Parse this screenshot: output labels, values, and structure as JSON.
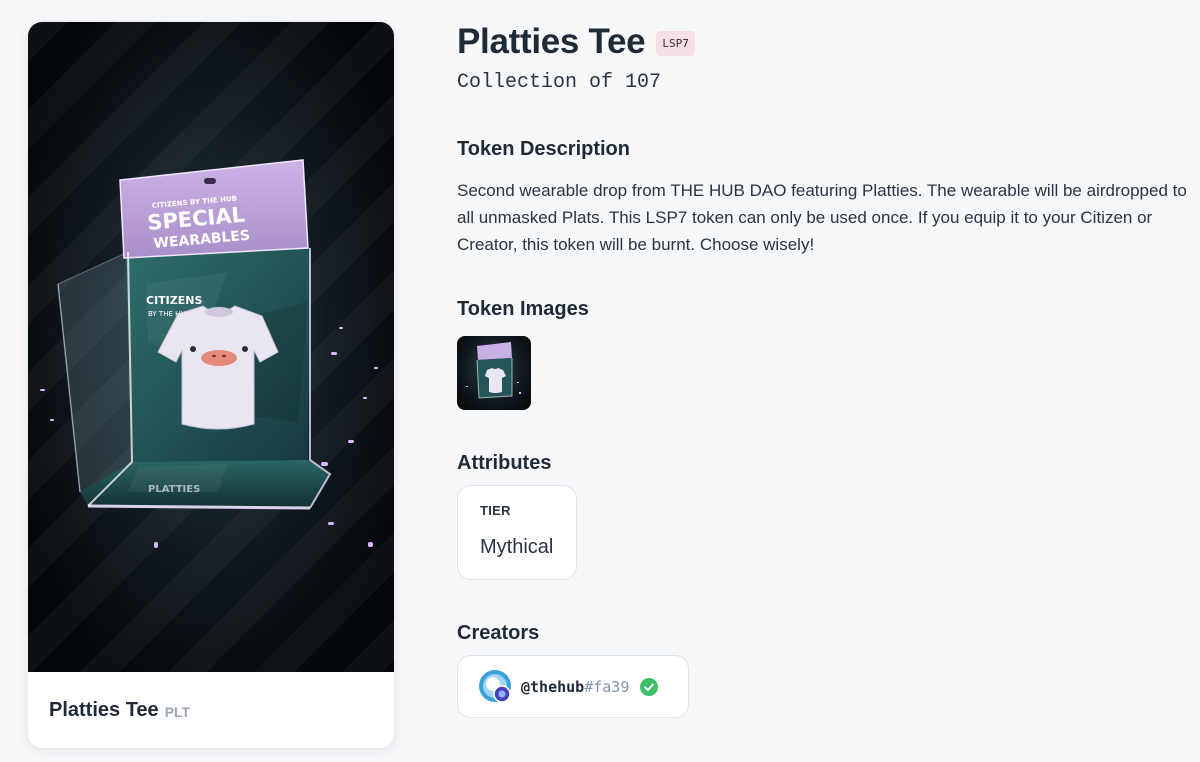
{
  "token": {
    "name": "Platties Tee",
    "symbol": "PLT",
    "standard": "LSP7",
    "collection_text": "Collection of 107"
  },
  "artwork": {
    "box_header_line1": "CITIZENS BY THE HUB",
    "box_header_line2": "SPECIAL",
    "box_header_line3": "WEARABLES",
    "inner_label_line1": "CITIZENS",
    "inner_label_line2": "BY THE HUB",
    "bottom_label": "PLATTIES"
  },
  "sections": {
    "description_heading": "Token Description",
    "description": "Second wearable drop from THE HUB DAO featuring Platties. The wearable will be airdropped to all unmasked Plats. This LSP7 token can only be used once. If you equip it to your Citizen or Creator, this token will be burnt. Choose wisely!",
    "images_heading": "Token Images",
    "attributes_heading": "Attributes",
    "creators_heading": "Creators"
  },
  "attributes": [
    {
      "key": "TIER",
      "value": "Mythical"
    }
  ],
  "creators": [
    {
      "name": "@thehub",
      "hash": "#fa39",
      "verified": true
    }
  ],
  "colors": {
    "background": "#f7f8fa",
    "badge_bg": "#f6dfe7",
    "verified_green": "#3fbf6a",
    "hash_color": "#7f93ad"
  },
  "icons": [
    "avatar-icon",
    "verified-check-icon"
  ]
}
